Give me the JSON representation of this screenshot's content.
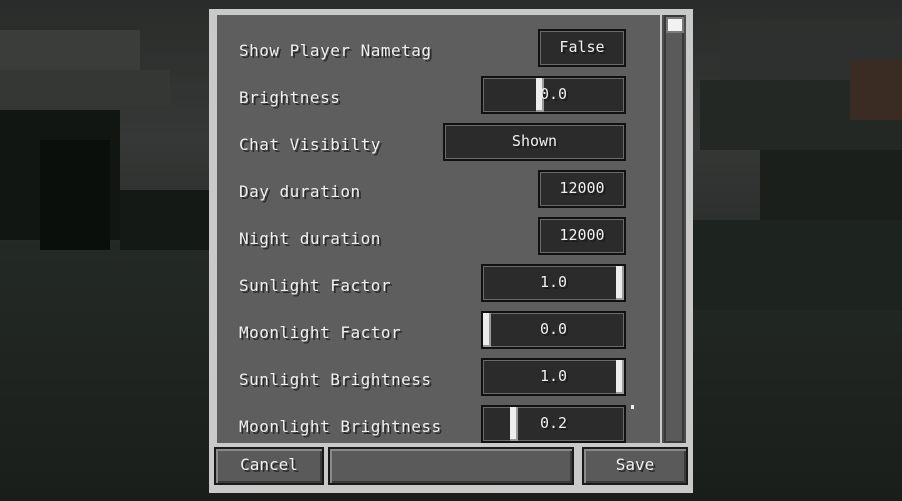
{
  "settings": {
    "rows": [
      {
        "label": "Show Player Nametag",
        "value": "False",
        "type": "button"
      },
      {
        "label": "Brightness",
        "value": "0.0",
        "type": "slider",
        "level": 0.4
      },
      {
        "label": "Chat Visibilty",
        "value": "Shown",
        "type": "button"
      },
      {
        "label": "Day duration",
        "value": "12000",
        "type": "field"
      },
      {
        "label": "Night duration",
        "value": "12000",
        "type": "field"
      },
      {
        "label": "Sunlight Factor",
        "value": "1.0",
        "type": "slider",
        "level": 1.0
      },
      {
        "label": "Moonlight Factor",
        "value": "0.0",
        "type": "slider",
        "level": 0.0
      },
      {
        "label": "Sunlight Brightness",
        "value": "1.0",
        "type": "slider",
        "level": 1.0
      },
      {
        "label": "Moonlight Brightness",
        "value": "0.2",
        "type": "slider",
        "level": 0.2
      }
    ]
  },
  "footer": {
    "cancel_label": "Cancel",
    "middle_label": "",
    "save_label": "Save"
  }
}
